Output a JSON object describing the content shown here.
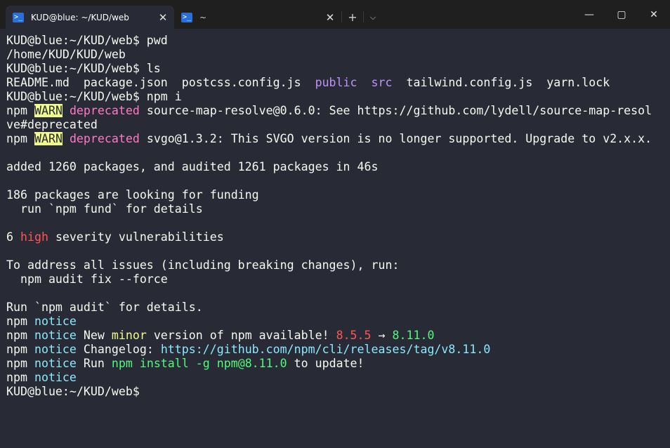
{
  "tabs": [
    {
      "title": "KUD@blue: ~/KUD/web",
      "close": "✕",
      "icon": "powershell-icon"
    },
    {
      "title": "~",
      "close": "✕",
      "icon": "powershell-icon"
    }
  ],
  "titlebar": {
    "new_tab": "+",
    "dropdown": "⌵"
  },
  "window_controls": {
    "minimize": "—",
    "maximize": "▢",
    "close": "✕"
  },
  "terminal": {
    "lines": [
      [
        {
          "t": "KUD@blue:~/KUD/web$ pwd"
        }
      ],
      [
        {
          "t": "/home/KUD/KUD/web"
        }
      ],
      [
        {
          "t": "KUD@blue:~/KUD/web$ ls"
        }
      ],
      [
        {
          "t": "README.md  package.json  postcss.config.js  "
        },
        {
          "t": "public",
          "c": "purple"
        },
        {
          "t": "  "
        },
        {
          "t": "src",
          "c": "purple"
        },
        {
          "t": "  tailwind.config.js  yarn.lock"
        }
      ],
      [
        {
          "t": "KUD@blue:~/KUD/web$ npm i"
        }
      ],
      [
        {
          "t": "npm "
        },
        {
          "t": "WARN",
          "c": "warn"
        },
        {
          "t": " "
        },
        {
          "t": "deprecated",
          "c": "pink"
        },
        {
          "t": " source-map-resolve@0.6.0: See https://github.com/lydell/source-map-resol"
        }
      ],
      [
        {
          "t": "ve#deprecated"
        }
      ],
      [
        {
          "t": "npm "
        },
        {
          "t": "WARN",
          "c": "warn"
        },
        {
          "t": " "
        },
        {
          "t": "deprecated",
          "c": "pink"
        },
        {
          "t": " svgo@1.3.2: This SVGO version is no longer supported. Upgrade to v2.x.x."
        }
      ],
      [
        {
          "t": ""
        }
      ],
      [
        {
          "t": "added 1260 packages, and audited 1261 packages in 46s"
        }
      ],
      [
        {
          "t": ""
        }
      ],
      [
        {
          "t": "186 packages are looking for funding"
        }
      ],
      [
        {
          "t": "  run `npm fund` for details"
        }
      ],
      [
        {
          "t": ""
        }
      ],
      [
        {
          "t": "6 "
        },
        {
          "t": "high",
          "c": "red"
        },
        {
          "t": " severity vulnerabilities"
        }
      ],
      [
        {
          "t": ""
        }
      ],
      [
        {
          "t": "To address all issues (including breaking changes), run:"
        }
      ],
      [
        {
          "t": "  npm audit fix --force"
        }
      ],
      [
        {
          "t": ""
        }
      ],
      [
        {
          "t": "Run `npm audit` for details."
        }
      ],
      [
        {
          "t": "npm "
        },
        {
          "t": "notice",
          "c": "cyan"
        }
      ],
      [
        {
          "t": "npm "
        },
        {
          "t": "notice",
          "c": "cyan"
        },
        {
          "t": " New "
        },
        {
          "t": "minor",
          "c": "yellow"
        },
        {
          "t": " version of npm available! "
        },
        {
          "t": "8.5.5",
          "c": "red"
        },
        {
          "t": " → "
        },
        {
          "t": "8.11.0",
          "c": "green"
        }
      ],
      [
        {
          "t": "npm "
        },
        {
          "t": "notice",
          "c": "cyan"
        },
        {
          "t": " Changelog: "
        },
        {
          "t": "https://github.com/npm/cli/releases/tag/v8.11.0",
          "c": "cyan"
        }
      ],
      [
        {
          "t": "npm "
        },
        {
          "t": "notice",
          "c": "cyan"
        },
        {
          "t": " Run "
        },
        {
          "t": "npm install -g npm@8.11.0",
          "c": "green"
        },
        {
          "t": " to update!"
        }
      ],
      [
        {
          "t": "npm "
        },
        {
          "t": "notice",
          "c": "cyan"
        }
      ],
      [
        {
          "t": "KUD@blue:~/KUD/web$"
        }
      ]
    ]
  },
  "colors": {
    "background": "#282a36",
    "foreground": "#f8f8f2",
    "titlebar": "#1f1f1f",
    "warn_bg": "#f1fa8c",
    "pink": "#ff79c6",
    "purple": "#bd93f9",
    "red": "#ff5555",
    "cyan": "#8be9fd",
    "yellow": "#f1fa8c",
    "green": "#50fa7b"
  }
}
